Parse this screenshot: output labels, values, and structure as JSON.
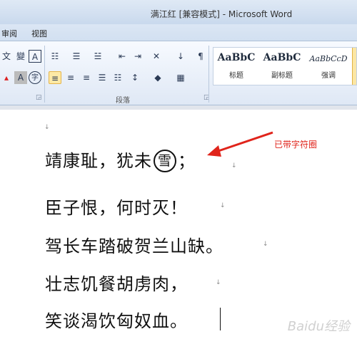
{
  "window": {
    "title": "满江红 [兼容模式] - Microsoft Word"
  },
  "tabs": [
    {
      "label": "审阅"
    },
    {
      "label": "视图"
    }
  ],
  "ribbon": {
    "paragraph_group_label": "段落",
    "styles": [
      {
        "sample": "AaBbC",
        "name": "标题"
      },
      {
        "sample": "AaBbC",
        "name": "副标题"
      },
      {
        "sample": "AaBbCcD",
        "name": "强调"
      }
    ],
    "font_buttons": {
      "char_border": "A",
      "enclosed_char": "字"
    }
  },
  "document": {
    "line1_before": "靖康耻，犹未",
    "enclosed_char": "雪",
    "line1_after": "；",
    "line2": "臣子恨，何时灭！",
    "line3": "驾长车踏破贺兰山缺。",
    "line4": "壮志饥餐胡虏肉，",
    "line5": "笑谈渴饮匈奴血。",
    "paragraph_mark": "↓"
  },
  "annotation": {
    "text": "已带字符圈",
    "color": "#e0241b"
  },
  "watermark": {
    "text": "Baidu经验"
  }
}
